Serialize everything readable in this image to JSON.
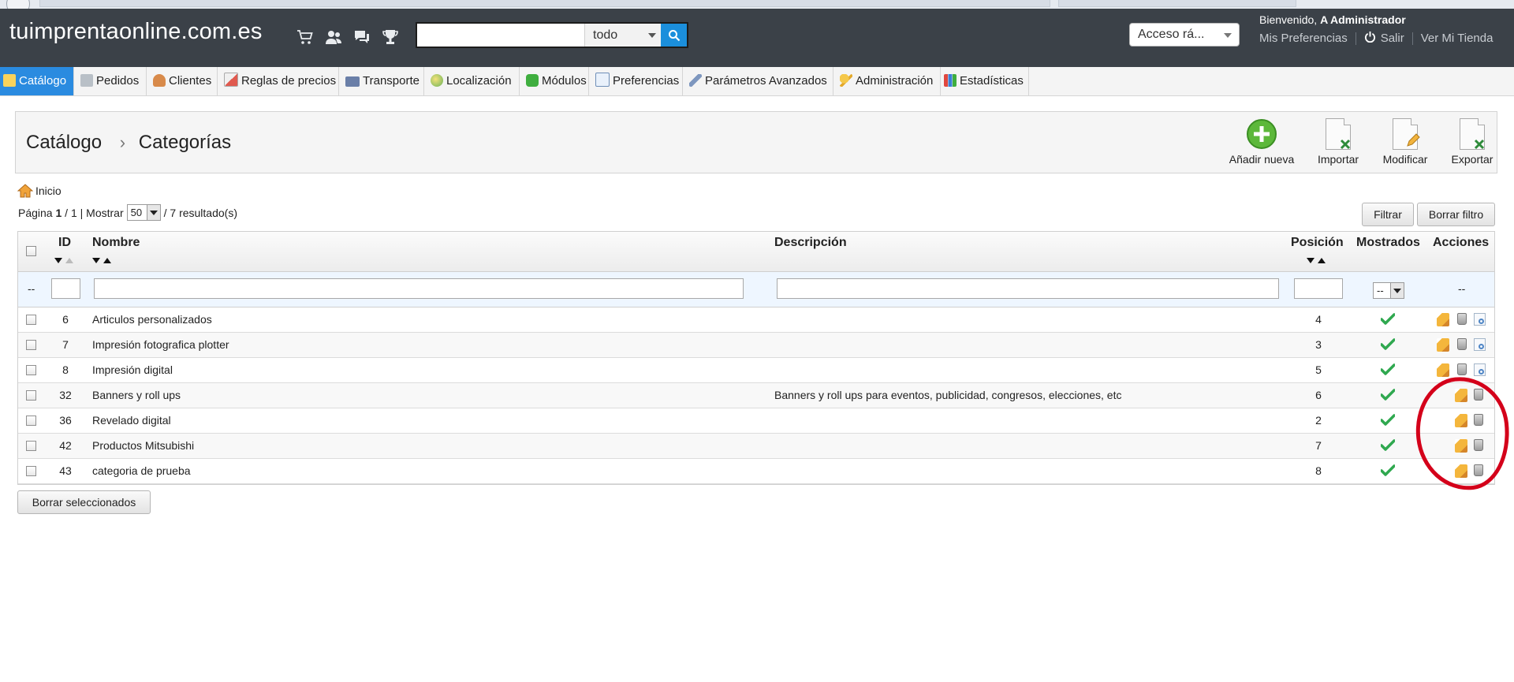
{
  "topbar": {
    "shop_name": "tuimprentaonline.com.es",
    "icons": [
      "cart-icon",
      "users-icon",
      "chat-icon",
      "trophy-icon"
    ],
    "search": {
      "value": "",
      "placeholder": "",
      "scope": "todo"
    },
    "quick_access": "Acceso rá...",
    "welcome_prefix": "Bienvenido,",
    "welcome_user": "A Administrador",
    "links": {
      "preferences": "Mis Preferencias",
      "logout": "Salir",
      "view_shop": "Ver Mi Tienda"
    }
  },
  "tabs": [
    {
      "label": "Catálogo",
      "icon": "folder-icon",
      "active": true
    },
    {
      "label": "Pedidos",
      "icon": "cart-icon"
    },
    {
      "label": "Clientes",
      "icon": "user-icon"
    },
    {
      "label": "Reglas de precios",
      "icon": "price-rules-icon"
    },
    {
      "label": "Transporte",
      "icon": "truck-icon"
    },
    {
      "label": "Localización",
      "icon": "globe-icon"
    },
    {
      "label": "Módulos",
      "icon": "puzzle-icon"
    },
    {
      "label": "Preferencias",
      "icon": "preferences-icon"
    },
    {
      "label": "Parámetros Avanzados",
      "icon": "wrench-icon"
    },
    {
      "label": "Administración",
      "icon": "key-icon"
    },
    {
      "label": "Estadísticas",
      "icon": "chart-icon"
    }
  ],
  "header": {
    "breadcrumb_root": "Catálogo",
    "breadcrumb_current": "Categorías",
    "toolbar": {
      "add": "Añadir nueva",
      "import": "Importar",
      "edit": "Modificar",
      "export": "Exportar"
    }
  },
  "home_link": "Inicio",
  "pagination": {
    "page_label": "Página",
    "page": "1",
    "of": "/ 1 | Mostrar",
    "per_page": "50",
    "results": "/ 7 resultado(s)"
  },
  "filter_buttons": {
    "filter": "Filtrar",
    "reset": "Borrar filtro"
  },
  "columns": {
    "id": "ID",
    "name": "Nombre",
    "description": "Descripción",
    "position": "Posición",
    "displayed": "Mostrados",
    "actions": "Acciones"
  },
  "filter_row": {
    "checkbox_placeholder": "--",
    "displayed_select": "--",
    "actions_placeholder": "--"
  },
  "rows": [
    {
      "id": "6",
      "name": "Articulos personalizados",
      "description": "",
      "position": "4",
      "displayed": true,
      "has_view": true
    },
    {
      "id": "7",
      "name": "Impresión fotografica plotter",
      "description": "",
      "position": "3",
      "displayed": true,
      "has_view": true
    },
    {
      "id": "8",
      "name": "Impresión digital",
      "description": "",
      "position": "5",
      "displayed": true,
      "has_view": true
    },
    {
      "id": "32",
      "name": "Banners y roll ups",
      "description": "Banners y roll ups para eventos, publicidad, congresos, elecciones, etc",
      "position": "6",
      "displayed": true,
      "has_view": false
    },
    {
      "id": "36",
      "name": "Revelado digital",
      "description": "",
      "position": "2",
      "displayed": true,
      "has_view": false
    },
    {
      "id": "42",
      "name": "Productos Mitsubishi",
      "description": "",
      "position": "7",
      "displayed": true,
      "has_view": false
    },
    {
      "id": "43",
      "name": "categoria de prueba",
      "description": "",
      "position": "8",
      "displayed": true,
      "has_view": false
    }
  ],
  "bulk_delete": "Borrar seleccionados",
  "colors": {
    "topbar": "#3b4148",
    "active_tab": "#2a8be0",
    "search_button": "#1b8fdc",
    "check_green": "#2fa84f",
    "annotation_red": "#d4001a"
  }
}
